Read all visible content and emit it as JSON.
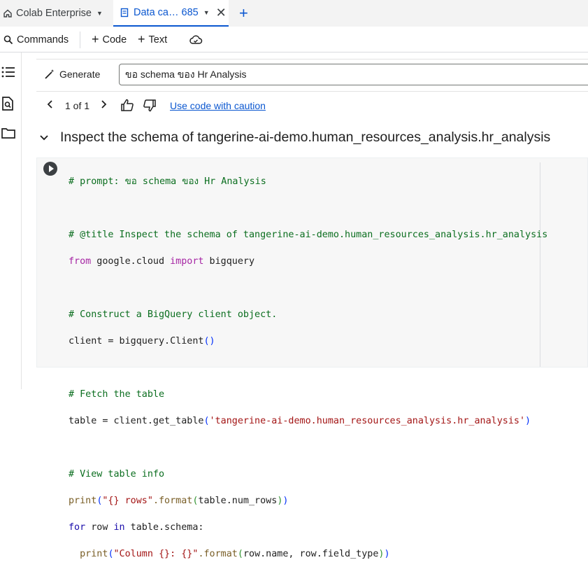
{
  "tabs": [
    {
      "label": "Colab Enterprise",
      "icon": "home-icon"
    },
    {
      "label": "Data ca… 685",
      "icon": "notebook-icon",
      "active": true
    }
  ],
  "toolbar": {
    "commands": "Commands",
    "code": "Code",
    "text": "Text"
  },
  "generate": {
    "button_label": "Generate",
    "prompt_value": "ขอ schema ของ Hr Analysis"
  },
  "pager": {
    "label": "1 of 1",
    "caution_link": "Use code with caution"
  },
  "section": {
    "title": "Inspect the schema of tangerine-ai-demo.human_resources_analysis.hr_analysis"
  },
  "code": {
    "l1": "# prompt: ขอ schema ของ Hr Analysis",
    "l2": "# @title Inspect the schema of tangerine-ai-demo.human_resources_analysis.hr_analysis",
    "l3a": "from",
    "l3b": " google.cloud ",
    "l3c": "import",
    "l3d": " bigquery",
    "l4": "# Construct a BigQuery client object.",
    "l5a": "client = bigquery.Client",
    "l5b": "()",
    "l6": "# Fetch the table",
    "l7a": "table = client.get_table",
    "l7b": "(",
    "l7c": "'tangerine-ai-demo.human_resources_analysis.hr_analysis'",
    "l7d": ")",
    "l8": "# View table info",
    "l9a": "print",
    "l9b": "(",
    "l9c": "\"{} rows\"",
    "l9d": ".format",
    "l9e": "(",
    "l9f": "table.num_rows",
    "l9g": ")",
    "l9h": ")",
    "l10a": "for",
    "l10b": " row ",
    "l10c": "in",
    "l10d": " table.schema:",
    "l11a": "  print",
    "l11b": "(",
    "l11c": "\"Column {}: {}\"",
    "l11d": ".format",
    "l11e": "(",
    "l11f": "row.name, row.field_type",
    "l11g": ")",
    "l11h": ")"
  },
  "colors": {
    "accent": "#0b57d0",
    "comment": "#0b6e1f",
    "keyword": "#a626a4",
    "string": "#a31515"
  }
}
